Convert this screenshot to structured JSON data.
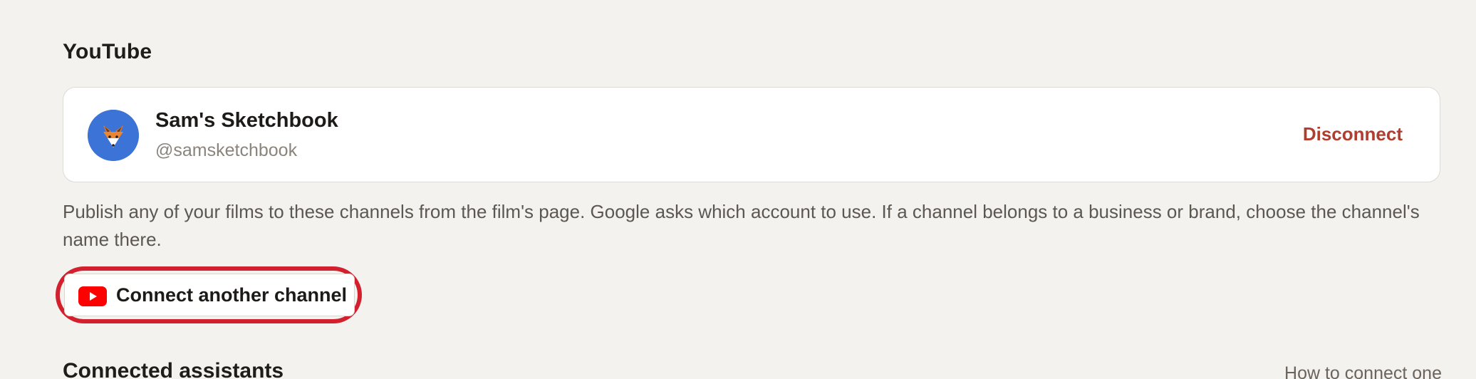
{
  "youtube": {
    "section_title": "YouTube",
    "channel": {
      "name": "Sam's Sketchbook",
      "handle": "@samsketchbook",
      "disconnect_label": "Disconnect",
      "avatar_icon": "fox-avatar-icon"
    },
    "help_text": "Publish any of your films to these channels from the film's page. Google asks which account to use. If a channel belongs to a business or brand, choose the channel's name there.",
    "connect_button": {
      "label": "Connect another channel",
      "icon": "youtube-icon"
    }
  },
  "assistants": {
    "section_title": "Connected assistants",
    "help_link": "How to connect one"
  },
  "colors": {
    "background": "#f4f2ef",
    "disconnect": "#b13d2f",
    "highlight_ring": "#d3202e",
    "youtube_red": "#ff0000",
    "avatar_blue": "#3b73d6"
  }
}
